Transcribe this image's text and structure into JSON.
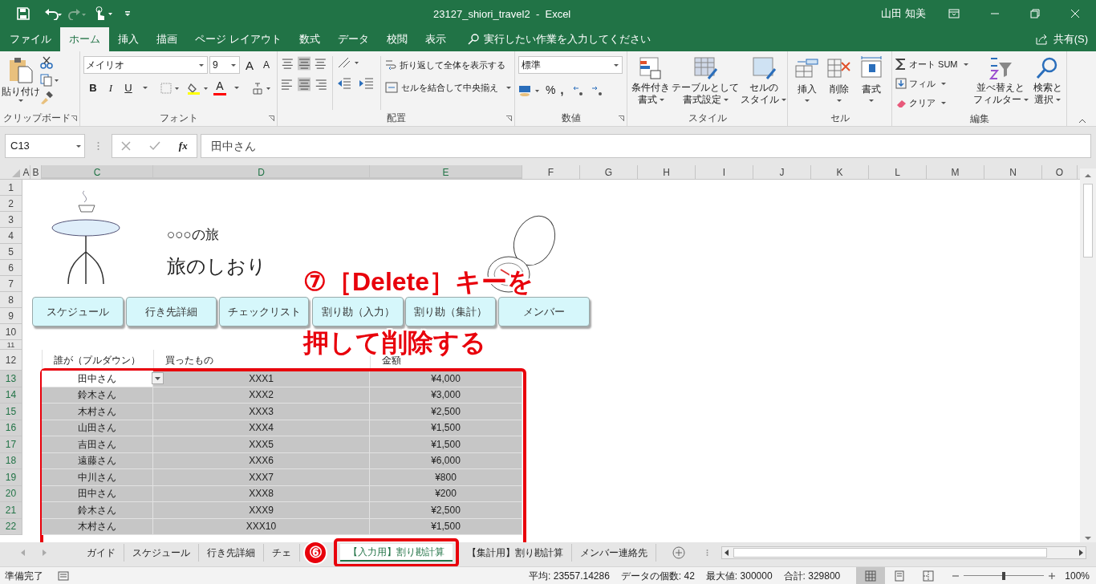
{
  "title_bar": {
    "title": "23127_shiori_travel2  -  Excel",
    "user": "山田 知美"
  },
  "menu_tabs": [
    {
      "label": "ファイル",
      "selected": false
    },
    {
      "label": "ホーム",
      "selected": true
    },
    {
      "label": "挿入",
      "selected": false
    },
    {
      "label": "描画",
      "selected": false
    },
    {
      "label": "ページ レイアウト",
      "selected": false
    },
    {
      "label": "数式",
      "selected": false
    },
    {
      "label": "データ",
      "selected": false
    },
    {
      "label": "校閲",
      "selected": false
    },
    {
      "label": "表示",
      "selected": false
    }
  ],
  "tell_me": "実行したい作業を入力してください",
  "share": "共有(S)",
  "ribbon": {
    "clipboard": {
      "label": "クリップボード",
      "paste": "貼り付け"
    },
    "font": {
      "label": "フォント",
      "font_name": "メイリオ",
      "font_size": "9",
      "grow": "A",
      "shrink": "A",
      "bold": "B",
      "italic": "I",
      "underline": "U",
      "font_color": "A"
    },
    "alignment": {
      "label": "配置",
      "wrap": "折り返して全体を表示する",
      "merge": "セルを結合して中央揃え"
    },
    "number": {
      "label": "数値",
      "format": "標準",
      "percent": "%",
      "comma": ","
    },
    "styles": {
      "label": "スタイル",
      "items": [
        {
          "lines": [
            "条件付き",
            "書式"
          ]
        },
        {
          "lines": [
            "テーブルとして",
            "書式設定"
          ]
        },
        {
          "lines": [
            "セルの",
            "スタイル"
          ]
        }
      ]
    },
    "cells": {
      "label": "セル",
      "items": [
        "挿入",
        "削除",
        "書式"
      ]
    },
    "editing": {
      "label": "編集",
      "autosum": "オート SUM",
      "fill": "フィル",
      "clear": "クリア",
      "sort": [
        "並べ替えと",
        "フィルター"
      ],
      "find": [
        "検索と",
        "選択"
      ]
    }
  },
  "formula_bar": {
    "name_box": "C13",
    "fx": "fx",
    "formula": "田中さん"
  },
  "columns": [
    {
      "label": "A",
      "selected": false
    },
    {
      "label": "B",
      "selected": false
    },
    {
      "label": "C",
      "selected": true
    },
    {
      "label": "D",
      "selected": true
    },
    {
      "label": "E",
      "selected": true
    },
    {
      "label": "F",
      "selected": false
    },
    {
      "label": "G",
      "selected": false
    },
    {
      "label": "H",
      "selected": false
    },
    {
      "label": "I",
      "selected": false
    },
    {
      "label": "J",
      "selected": false
    },
    {
      "label": "K",
      "selected": false
    },
    {
      "label": "L",
      "selected": false
    },
    {
      "label": "M",
      "selected": false
    },
    {
      "label": "N",
      "selected": false
    },
    {
      "label": "O",
      "selected": false
    }
  ],
  "sheet": {
    "subtitle": "○○○の旅",
    "title": "旅のしおり",
    "nav_buttons": [
      "スケジュール",
      "行き先詳細",
      "チェックリスト",
      "割り勘（入力）",
      "割り勘（集計）",
      "メンバー"
    ],
    "table_headers": [
      "誰が（プルダウン）",
      "買ったもの",
      "金額"
    ],
    "rows": [
      {
        "who": "田中さん",
        "item": "XXX1",
        "amount": "¥4,000",
        "active": true
      },
      {
        "who": "鈴木さん",
        "item": "XXX2",
        "amount": "¥3,000",
        "active": false
      },
      {
        "who": "木村さん",
        "item": "XXX3",
        "amount": "¥2,500",
        "active": false
      },
      {
        "who": "山田さん",
        "item": "XXX4",
        "amount": "¥1,500",
        "active": false
      },
      {
        "who": "吉田さん",
        "item": "XXX5",
        "amount": "¥1,500",
        "active": false
      },
      {
        "who": "遠藤さん",
        "item": "XXX6",
        "amount": "¥6,000",
        "active": false
      },
      {
        "who": "中川さん",
        "item": "XXX7",
        "amount": "¥800",
        "active": false
      },
      {
        "who": "田中さん",
        "item": "XXX8",
        "amount": "¥200",
        "active": false
      },
      {
        "who": "鈴木さん",
        "item": "XXX9",
        "amount": "¥2,500",
        "active": false
      },
      {
        "who": "木村さん",
        "item": "XXX10",
        "amount": "¥1,500",
        "active": false
      }
    ]
  },
  "row_numbers": [
    "1",
    "2",
    "3",
    "4",
    "5",
    "6",
    "7",
    "8",
    "9",
    "10",
    "11",
    "12",
    "13",
    "14",
    "15",
    "16",
    "17",
    "18",
    "19",
    "20",
    "21",
    "22"
  ],
  "annotations": {
    "step7_lines": [
      "⑦［Delete］キーを",
      "押して削除する"
    ],
    "step6": "⑥"
  },
  "sheet_tabs": [
    {
      "label": "ガイド",
      "selected": false
    },
    {
      "label": "スケジュール",
      "selected": false
    },
    {
      "label": "行き先詳細",
      "selected": false
    },
    {
      "label": "チェ",
      "selected": false
    },
    {
      "label": "【入力用】割り勘計算",
      "selected": true
    },
    {
      "label": "【集計用】割り勘計算",
      "selected": false
    },
    {
      "label": "メンバー連絡先",
      "selected": false
    }
  ],
  "status_bar": {
    "ready": "準備完了",
    "stats": [
      "平均: 23557.14286",
      "データの個数: 42",
      "最大値: 300000",
      "合計: 329800"
    ],
    "views": [
      {
        "kind": "normal",
        "selected": true
      },
      {
        "kind": "layout",
        "selected": false
      },
      {
        "kind": "pagebreak",
        "selected": false
      }
    ],
    "zoom": {
      "level": 0.5,
      "reading": "100%"
    }
  }
}
